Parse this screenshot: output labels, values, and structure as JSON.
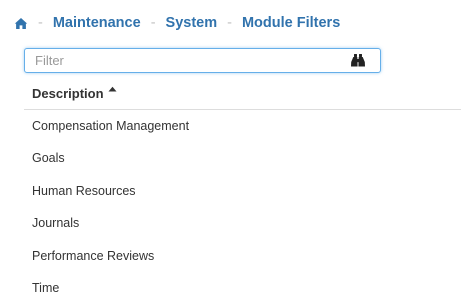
{
  "breadcrumb": {
    "home_icon": "home-icon",
    "separator": "-",
    "items": [
      {
        "label": "Maintenance"
      },
      {
        "label": "System"
      },
      {
        "label": "Module Filters"
      }
    ]
  },
  "filter": {
    "placeholder": "Filter",
    "value": "",
    "search_icon": "binoculars-icon"
  },
  "table": {
    "column_header": "Description",
    "sort_direction": "ascending",
    "rows": [
      {
        "description": "Compensation Management"
      },
      {
        "description": "Goals"
      },
      {
        "description": "Human Resources"
      },
      {
        "description": "Journals"
      },
      {
        "description": "Performance Reviews"
      },
      {
        "description": "Time"
      }
    ]
  },
  "colors": {
    "link": "#3173ad",
    "separator": "#c2c2c2",
    "focus_border": "#66afe9",
    "text": "#333333",
    "divider": "#dddddd"
  }
}
